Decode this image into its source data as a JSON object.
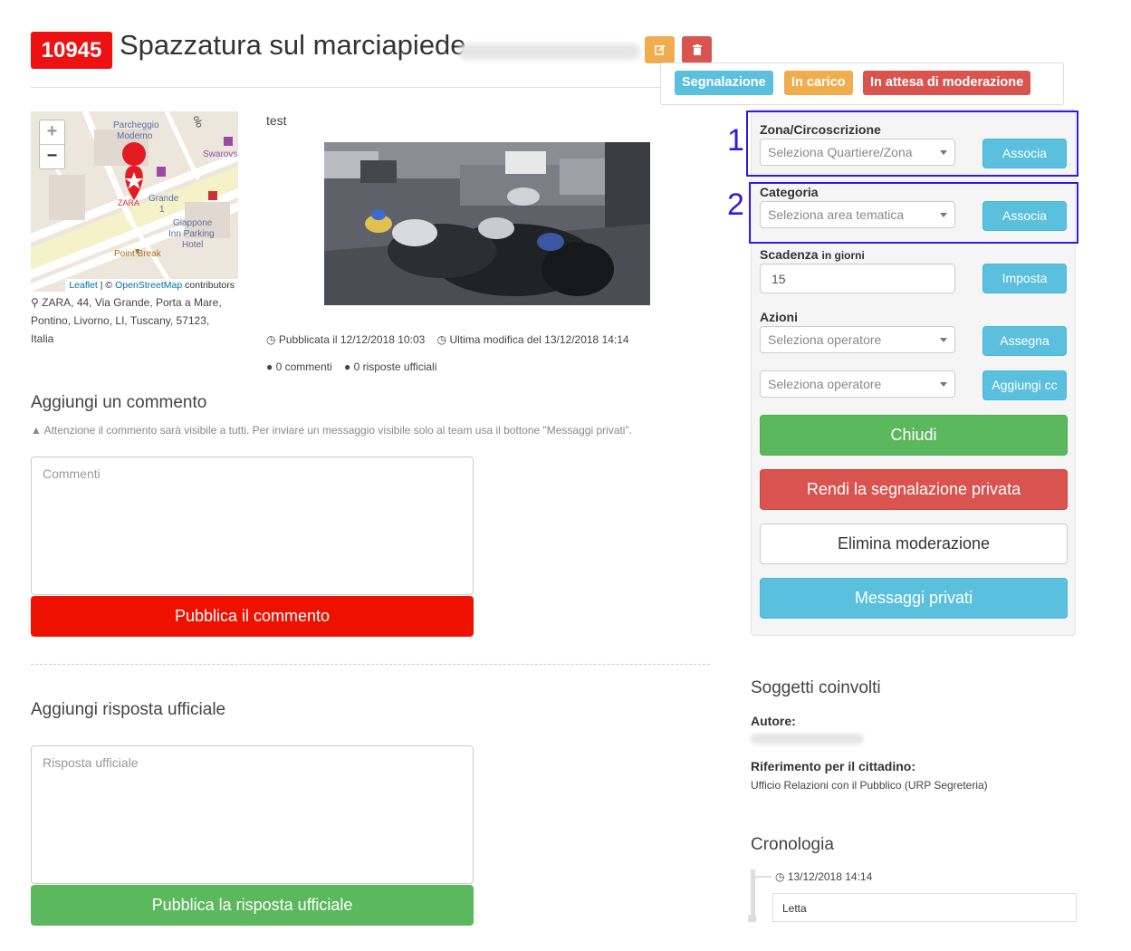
{
  "header": {
    "id": "10945",
    "title": "Spazzatura sul marciapiede",
    "edit_icon": "edit-icon",
    "delete_icon": "trash-icon"
  },
  "labels": [
    "Segnalazione",
    "In carico",
    "In attesa di moderazione"
  ],
  "label_colors": {
    "segnalazione": "#5bc0de",
    "in_carico": "#f0ad4e",
    "moderazione": "#d9534f"
  },
  "map": {
    "zoom_in": "+",
    "zoom_out": "−",
    "place_labels": [
      "Parcheggio",
      "Moderno",
      "Swarovs",
      "ZARA",
      "Grande",
      "1",
      "Giappone",
      "Inn Parking",
      "Hotel",
      "Point Break",
      "olo"
    ],
    "attribution_leaflet": "Leaflet",
    "attribution_sep": " | © ",
    "attribution_osm": "OpenStreetMap",
    "attribution_suffix": " contributors"
  },
  "address": "ZARA, 44, Via Grande, Porta a Mare, Pontino, Livorno, LI, Tuscany, 57123, Italia",
  "report": {
    "description": "test",
    "published": "Pubblicata il 12/12/2018 10:03",
    "modified": "Ultima modifica del 13/12/2018 14:14",
    "comments_count": "0 commenti",
    "official_count": "0 risposte ufficiali"
  },
  "comment_section": {
    "title": "Aggiungi un commento",
    "warning": "Attenzione il commento sarà visibile a tutti. Per inviare un messaggio visibile solo al team usa il bottone \"Messaggi privati\".",
    "placeholder": "Commenti",
    "button": "Pubblica il commento"
  },
  "official_section": {
    "title": "Aggiungi risposta ufficiale",
    "placeholder": "Risposta ufficiale",
    "button": "Pubblica la risposta ufficiale"
  },
  "panel": {
    "zona_label": "Zona/Circoscrizione",
    "zona_placeholder": "Seleziona Quartiere/Zona",
    "zona_button": "Associa",
    "categoria_label": "Categoria",
    "categoria_placeholder": "Seleziona area tematica",
    "categoria_button": "Associa",
    "scadenza_label": "Scadenza",
    "scadenza_small": "in giorni",
    "scadenza_value": "15",
    "scadenza_button": "Imposta",
    "azioni_label": "Azioni",
    "operatore_placeholder_1": "Seleziona operatore",
    "assegna_button": "Assegna",
    "operatore_placeholder_2": "Seleziona operatore",
    "cc_button": "Aggiungi cc",
    "chiudi": "Chiudi",
    "privata": "Rendi la segnalazione privata",
    "elimina": "Elimina moderazione",
    "messaggi": "Messaggi privati",
    "annotation_1": "1",
    "annotation_2": "2"
  },
  "soggetti": {
    "title": "Soggetti coinvolti",
    "autore_label": "Autore:",
    "riferimento_label": "Riferimento per il cittadino:",
    "riferimento_value": "Ufficio Relazioni con il Pubblico (URP Segreteria)"
  },
  "cronologia": {
    "title": "Cronologia",
    "timestamp": "13/12/2018 14:14",
    "event": "Letta"
  }
}
